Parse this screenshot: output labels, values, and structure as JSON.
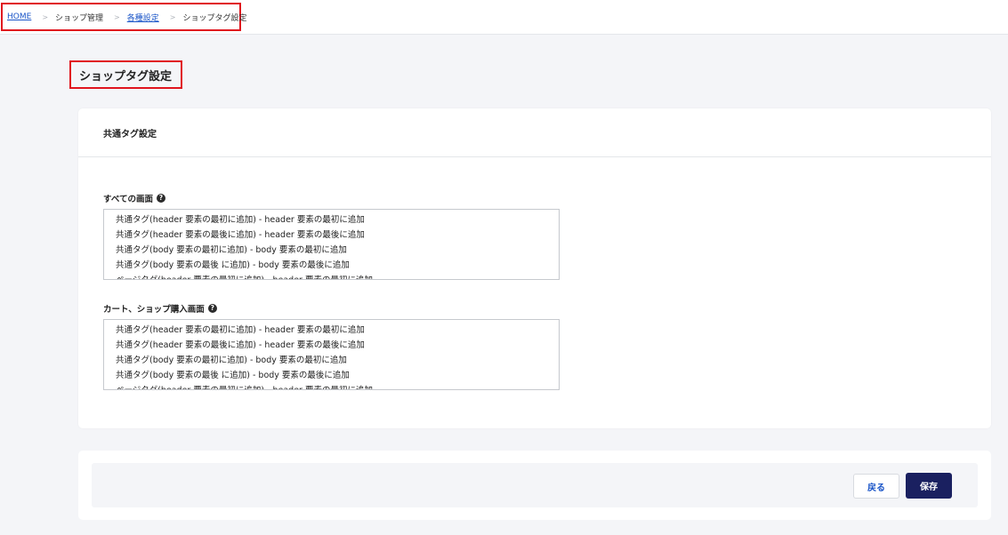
{
  "breadcrumb": {
    "home": "HOME",
    "shop_admin": "ショップ管理",
    "settings": "各種設定",
    "current": "ショップタグ設定",
    "separator": ">"
  },
  "page": {
    "title": "ショップタグ設定"
  },
  "card": {
    "header": "共通タグ設定",
    "all_screens": {
      "label": "すべての画面",
      "options": [
        "共通タグ(header 要素の最初に追加) - header 要素の最初に追加",
        "共通タグ(header 要素の最後に追加) - header 要素の最後に追加",
        "共通タグ(body 要素の最初に追加) - body 要素の最初に追加",
        "共通タグ(body 要素の最後 に追加) - body 要素の最後に追加",
        "ページタグ(header 要素の最初に追加) - header 要素の最初に追加"
      ]
    },
    "cart_screens": {
      "label": "カート、ショップ購入画面",
      "options": [
        "共通タグ(header 要素の最初に追加) - header 要素の最初に追加",
        "共通タグ(header 要素の最後に追加) - header 要素の最後に追加",
        "共通タグ(body 要素の最初に追加) - body 要素の最初に追加",
        "共通タグ(body 要素の最後 に追加) - body 要素の最後に追加",
        "ページタグ(header 要素の最初に追加) - header 要素の最初に追加"
      ]
    }
  },
  "footer": {
    "back_label": "戻る",
    "save_label": "保存"
  },
  "icons": {
    "help": "question-circle-icon"
  }
}
